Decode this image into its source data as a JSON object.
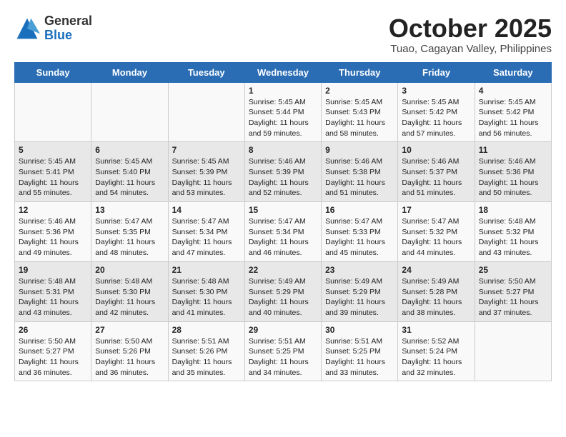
{
  "header": {
    "logo_general": "General",
    "logo_blue": "Blue",
    "month_title": "October 2025",
    "subtitle": "Tuao, Cagayan Valley, Philippines"
  },
  "days_of_week": [
    "Sunday",
    "Monday",
    "Tuesday",
    "Wednesday",
    "Thursday",
    "Friday",
    "Saturday"
  ],
  "weeks": [
    [
      {
        "day": "",
        "info": ""
      },
      {
        "day": "",
        "info": ""
      },
      {
        "day": "",
        "info": ""
      },
      {
        "day": "1",
        "info": "Sunrise: 5:45 AM\nSunset: 5:44 PM\nDaylight: 11 hours\nand 59 minutes."
      },
      {
        "day": "2",
        "info": "Sunrise: 5:45 AM\nSunset: 5:43 PM\nDaylight: 11 hours\nand 58 minutes."
      },
      {
        "day": "3",
        "info": "Sunrise: 5:45 AM\nSunset: 5:42 PM\nDaylight: 11 hours\nand 57 minutes."
      },
      {
        "day": "4",
        "info": "Sunrise: 5:45 AM\nSunset: 5:42 PM\nDaylight: 11 hours\nand 56 minutes."
      }
    ],
    [
      {
        "day": "5",
        "info": "Sunrise: 5:45 AM\nSunset: 5:41 PM\nDaylight: 11 hours\nand 55 minutes."
      },
      {
        "day": "6",
        "info": "Sunrise: 5:45 AM\nSunset: 5:40 PM\nDaylight: 11 hours\nand 54 minutes."
      },
      {
        "day": "7",
        "info": "Sunrise: 5:45 AM\nSunset: 5:39 PM\nDaylight: 11 hours\nand 53 minutes."
      },
      {
        "day": "8",
        "info": "Sunrise: 5:46 AM\nSunset: 5:39 PM\nDaylight: 11 hours\nand 52 minutes."
      },
      {
        "day": "9",
        "info": "Sunrise: 5:46 AM\nSunset: 5:38 PM\nDaylight: 11 hours\nand 51 minutes."
      },
      {
        "day": "10",
        "info": "Sunrise: 5:46 AM\nSunset: 5:37 PM\nDaylight: 11 hours\nand 51 minutes."
      },
      {
        "day": "11",
        "info": "Sunrise: 5:46 AM\nSunset: 5:36 PM\nDaylight: 11 hours\nand 50 minutes."
      }
    ],
    [
      {
        "day": "12",
        "info": "Sunrise: 5:46 AM\nSunset: 5:36 PM\nDaylight: 11 hours\nand 49 minutes."
      },
      {
        "day": "13",
        "info": "Sunrise: 5:47 AM\nSunset: 5:35 PM\nDaylight: 11 hours\nand 48 minutes."
      },
      {
        "day": "14",
        "info": "Sunrise: 5:47 AM\nSunset: 5:34 PM\nDaylight: 11 hours\nand 47 minutes."
      },
      {
        "day": "15",
        "info": "Sunrise: 5:47 AM\nSunset: 5:34 PM\nDaylight: 11 hours\nand 46 minutes."
      },
      {
        "day": "16",
        "info": "Sunrise: 5:47 AM\nSunset: 5:33 PM\nDaylight: 11 hours\nand 45 minutes."
      },
      {
        "day": "17",
        "info": "Sunrise: 5:47 AM\nSunset: 5:32 PM\nDaylight: 11 hours\nand 44 minutes."
      },
      {
        "day": "18",
        "info": "Sunrise: 5:48 AM\nSunset: 5:32 PM\nDaylight: 11 hours\nand 43 minutes."
      }
    ],
    [
      {
        "day": "19",
        "info": "Sunrise: 5:48 AM\nSunset: 5:31 PM\nDaylight: 11 hours\nand 43 minutes."
      },
      {
        "day": "20",
        "info": "Sunrise: 5:48 AM\nSunset: 5:30 PM\nDaylight: 11 hours\nand 42 minutes."
      },
      {
        "day": "21",
        "info": "Sunrise: 5:48 AM\nSunset: 5:30 PM\nDaylight: 11 hours\nand 41 minutes."
      },
      {
        "day": "22",
        "info": "Sunrise: 5:49 AM\nSunset: 5:29 PM\nDaylight: 11 hours\nand 40 minutes."
      },
      {
        "day": "23",
        "info": "Sunrise: 5:49 AM\nSunset: 5:29 PM\nDaylight: 11 hours\nand 39 minutes."
      },
      {
        "day": "24",
        "info": "Sunrise: 5:49 AM\nSunset: 5:28 PM\nDaylight: 11 hours\nand 38 minutes."
      },
      {
        "day": "25",
        "info": "Sunrise: 5:50 AM\nSunset: 5:27 PM\nDaylight: 11 hours\nand 37 minutes."
      }
    ],
    [
      {
        "day": "26",
        "info": "Sunrise: 5:50 AM\nSunset: 5:27 PM\nDaylight: 11 hours\nand 36 minutes."
      },
      {
        "day": "27",
        "info": "Sunrise: 5:50 AM\nSunset: 5:26 PM\nDaylight: 11 hours\nand 36 minutes."
      },
      {
        "day": "28",
        "info": "Sunrise: 5:51 AM\nSunset: 5:26 PM\nDaylight: 11 hours\nand 35 minutes."
      },
      {
        "day": "29",
        "info": "Sunrise: 5:51 AM\nSunset: 5:25 PM\nDaylight: 11 hours\nand 34 minutes."
      },
      {
        "day": "30",
        "info": "Sunrise: 5:51 AM\nSunset: 5:25 PM\nDaylight: 11 hours\nand 33 minutes."
      },
      {
        "day": "31",
        "info": "Sunrise: 5:52 AM\nSunset: 5:24 PM\nDaylight: 11 hours\nand 32 minutes."
      },
      {
        "day": "",
        "info": ""
      }
    ]
  ]
}
